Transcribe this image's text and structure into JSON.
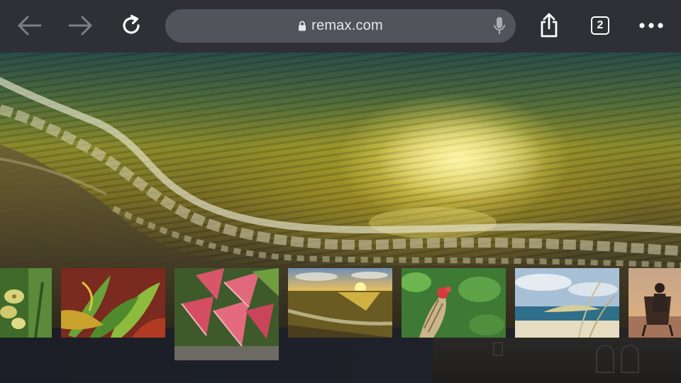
{
  "browser": {
    "url": "remax.com",
    "tab_count": "2",
    "icons": {
      "back": "arrow-left-icon",
      "forward": "arrow-right-icon",
      "reload": "reload-icon",
      "lock": "lock-icon",
      "mic": "microphone-icon",
      "share": "share-icon",
      "tabs": "tabs-icon",
      "more": "more-dots-icon"
    },
    "colors": {
      "toolbar": "#2e3035",
      "urlbar": "#51545a",
      "icon_active": "#ffffff",
      "icon_disabled": "#7c7f85"
    }
  },
  "hero": {
    "subject": "sunset-beach-waves-photo"
  },
  "gallery": {
    "thumbnails": [
      {
        "subject": "yellow-orchid-photo"
      },
      {
        "subject": "croton-plant-photo"
      },
      {
        "subject": "pink-caladium-leaves-photo"
      },
      {
        "subject": "ocean-sunset-photo"
      },
      {
        "subject": "tropical-flower-bud-photo"
      },
      {
        "subject": "beach-sea-oats-photo"
      },
      {
        "subject": "beach-chair-person-photo"
      }
    ]
  }
}
